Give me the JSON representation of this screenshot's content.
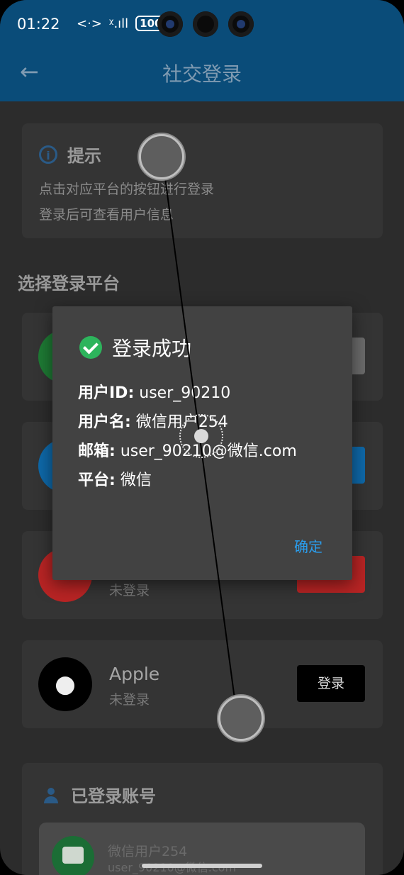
{
  "status": {
    "time": "01:22",
    "network": "<·>",
    "signal": "ᵡ.ıll",
    "battery": "100"
  },
  "appbar": {
    "title": "社交登录"
  },
  "tip": {
    "title": "提示",
    "lines": [
      "点击对应平台的按钮进行登录",
      "登录后可查看用户信息"
    ]
  },
  "section": {
    "title": "选择登录平台"
  },
  "platforms": [
    {
      "name": "",
      "status": "",
      "button": "",
      "avatar_color": "#1e7a34",
      "button_color": "#6b6b6b"
    },
    {
      "name": "",
      "status": "",
      "button": "",
      "avatar_color": "#0e68a8",
      "button_color": "#0e68a8"
    },
    {
      "name": "",
      "status": "未登录",
      "button": "",
      "avatar_color": "#b82424",
      "button_color": "#b82424"
    },
    {
      "name": "Apple",
      "status": "未登录",
      "button": "登录",
      "avatar_color": "#000000",
      "button_color": "#000000"
    }
  ],
  "logged": {
    "title": "已登录账号",
    "account_name": "微信用户254",
    "account_sub": "user_90210@微信.com"
  },
  "dialog": {
    "title": "登录成功",
    "rows": [
      {
        "label": "用户ID:",
        "value": "user_90210"
      },
      {
        "label": "用户名:",
        "value": "微信用户254"
      },
      {
        "label": "邮箱:",
        "value": "user_90210@微信.com"
      },
      {
        "label": "平台:",
        "value": "微信"
      }
    ],
    "ok_label": "确定"
  },
  "colors": {
    "appbar": "#0a4c79",
    "accent": "#2a9ff0",
    "success": "#2db45c"
  }
}
